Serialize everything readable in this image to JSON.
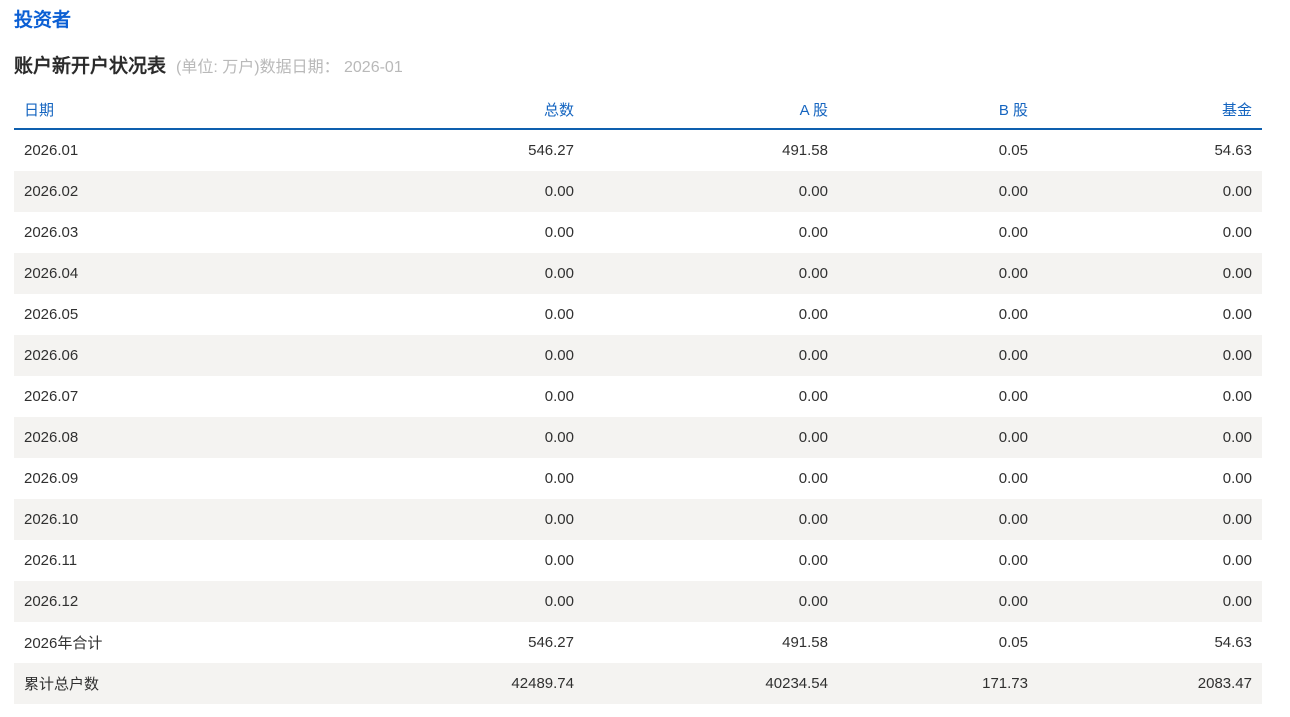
{
  "colors": {
    "accent-blue": "#0b5fd4",
    "header-blue": "#1565c0",
    "line-blue": "#0e5fae",
    "row-alt-bg": "#f4f3f1",
    "note-gray": "#b9b9b9",
    "title-dark": "#2b2b2b",
    "text-dark": "#303030"
  },
  "header": {
    "section_title": "投资者",
    "table_title": "账户新开户状况表",
    "note": "(单位: 万户)数据日期： 2026-01"
  },
  "table": {
    "columns": [
      "日期",
      "总数",
      "A 股",
      "B 股",
      "基金"
    ],
    "rows": [
      {
        "date": "2026.01",
        "total": "546.27",
        "a_share": "491.58",
        "b_share": "0.05",
        "fund": "54.63"
      },
      {
        "date": "2026.02",
        "total": "0.00",
        "a_share": "0.00",
        "b_share": "0.00",
        "fund": "0.00"
      },
      {
        "date": "2026.03",
        "total": "0.00",
        "a_share": "0.00",
        "b_share": "0.00",
        "fund": "0.00"
      },
      {
        "date": "2026.04",
        "total": "0.00",
        "a_share": "0.00",
        "b_share": "0.00",
        "fund": "0.00"
      },
      {
        "date": "2026.05",
        "total": "0.00",
        "a_share": "0.00",
        "b_share": "0.00",
        "fund": "0.00"
      },
      {
        "date": "2026.06",
        "total": "0.00",
        "a_share": "0.00",
        "b_share": "0.00",
        "fund": "0.00"
      },
      {
        "date": "2026.07",
        "total": "0.00",
        "a_share": "0.00",
        "b_share": "0.00",
        "fund": "0.00"
      },
      {
        "date": "2026.08",
        "total": "0.00",
        "a_share": "0.00",
        "b_share": "0.00",
        "fund": "0.00"
      },
      {
        "date": "2026.09",
        "total": "0.00",
        "a_share": "0.00",
        "b_share": "0.00",
        "fund": "0.00"
      },
      {
        "date": "2026.10",
        "total": "0.00",
        "a_share": "0.00",
        "b_share": "0.00",
        "fund": "0.00"
      },
      {
        "date": "2026.11",
        "total": "0.00",
        "a_share": "0.00",
        "b_share": "0.00",
        "fund": "0.00"
      },
      {
        "date": "2026.12",
        "total": "0.00",
        "a_share": "0.00",
        "b_share": "0.00",
        "fund": "0.00"
      },
      {
        "date": "2026年合计",
        "total": "546.27",
        "a_share": "491.58",
        "b_share": "0.05",
        "fund": "54.63"
      },
      {
        "date": "累计总户数",
        "total": "42489.74",
        "a_share": "40234.54",
        "b_share": "171.73",
        "fund": "2083.47"
      }
    ]
  }
}
